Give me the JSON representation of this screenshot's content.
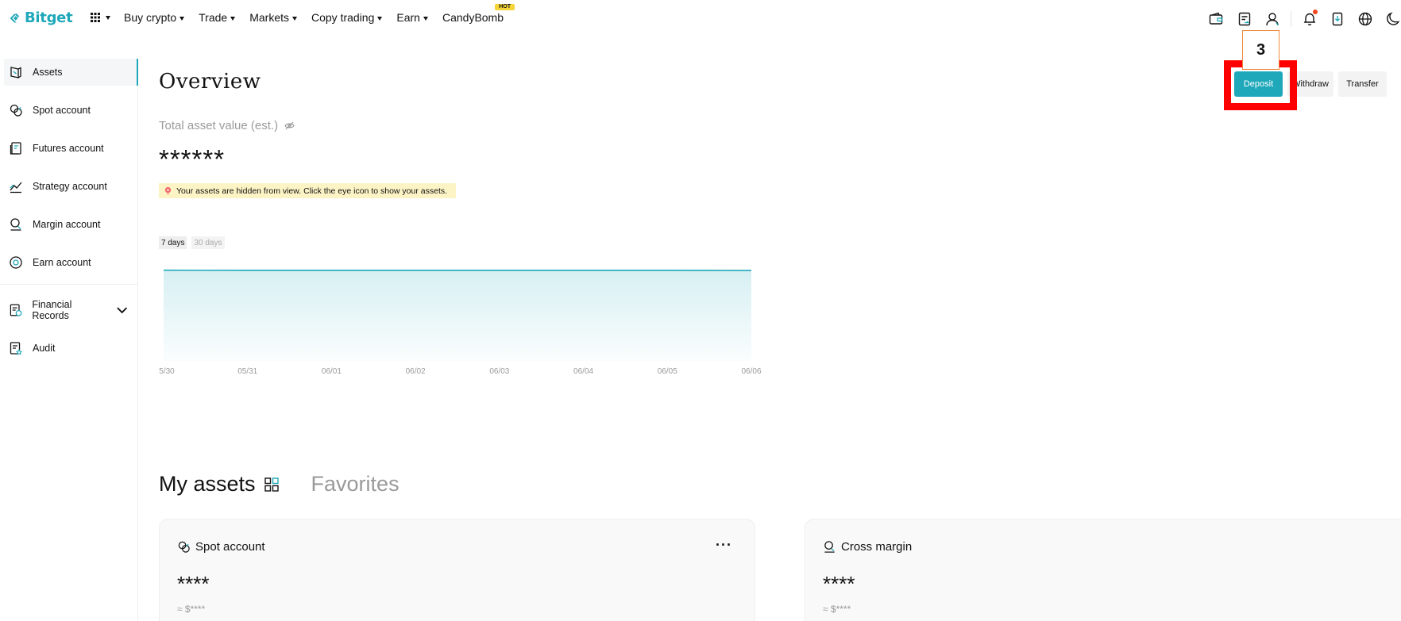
{
  "brand": {
    "name": "Bitget",
    "color": "#1fa8ba"
  },
  "nav": {
    "items": [
      {
        "label": "Buy crypto",
        "has_caret": true
      },
      {
        "label": "Trade",
        "has_caret": true
      },
      {
        "label": "Markets",
        "has_caret": true
      },
      {
        "label": "Copy trading",
        "has_caret": true
      },
      {
        "label": "Earn",
        "has_caret": true
      },
      {
        "label": "CandyBomb",
        "has_caret": false,
        "badge": "HOT"
      }
    ],
    "right_icons": [
      "wallet-icon",
      "orders-icon",
      "user-icon",
      "bell-icon",
      "download-icon",
      "globe-icon",
      "moon-icon"
    ]
  },
  "sidebar": {
    "items": [
      {
        "label": "Assets",
        "icon": "assets-icon",
        "active": true
      },
      {
        "label": "Spot account",
        "icon": "spot-account-icon"
      },
      {
        "label": "Futures account",
        "icon": "futures-account-icon"
      },
      {
        "label": "Strategy account",
        "icon": "strategy-account-icon"
      },
      {
        "label": "Margin account",
        "icon": "margin-account-icon"
      },
      {
        "label": "Earn account",
        "icon": "earn-account-icon"
      },
      {
        "label": "Financial Records",
        "icon": "financial-records-icon",
        "expandable": true
      },
      {
        "label": "Audit",
        "icon": "audit-icon"
      }
    ]
  },
  "overview": {
    "title": "Overview",
    "total_label": "Total asset value (est.)",
    "total_value": "******",
    "hidden_note": "Your assets are hidden from view. Click the eye icon to show your assets.",
    "range_tabs": [
      {
        "label": "7 days",
        "active": true
      },
      {
        "label": "30 days",
        "active": false
      }
    ]
  },
  "actions": {
    "deposit": "Deposit",
    "withdraw": "Withdraw",
    "transfer": "Transfer"
  },
  "annotation": {
    "step": "3"
  },
  "chart_data": {
    "type": "area",
    "categories": [
      "05/30",
      "05/31",
      "06/01",
      "06/02",
      "06/03",
      "06/04",
      "06/05",
      "06/06"
    ],
    "x_labels": [
      "5/30",
      "05/31",
      "06/01",
      "06/02",
      "06/03",
      "06/04",
      "06/05",
      "06/06"
    ],
    "values": [
      1.0,
      0.999,
      0.999,
      0.999,
      0.9995,
      0.9995,
      0.9995,
      0.997
    ],
    "ylim": [
      0,
      1.05
    ],
    "grid": false,
    "color": "#1fa8ba"
  },
  "my_assets": {
    "title": "My assets",
    "favorites": "Favorites",
    "cards": [
      {
        "title": "Spot account",
        "value": "****",
        "approx": "≈ $****",
        "icon": "spot-account-icon",
        "has_more": true
      },
      {
        "title": "Cross margin",
        "value": "****",
        "approx": "≈ $****",
        "icon": "margin-account-icon",
        "has_more": false
      }
    ],
    "more_label": "···"
  }
}
